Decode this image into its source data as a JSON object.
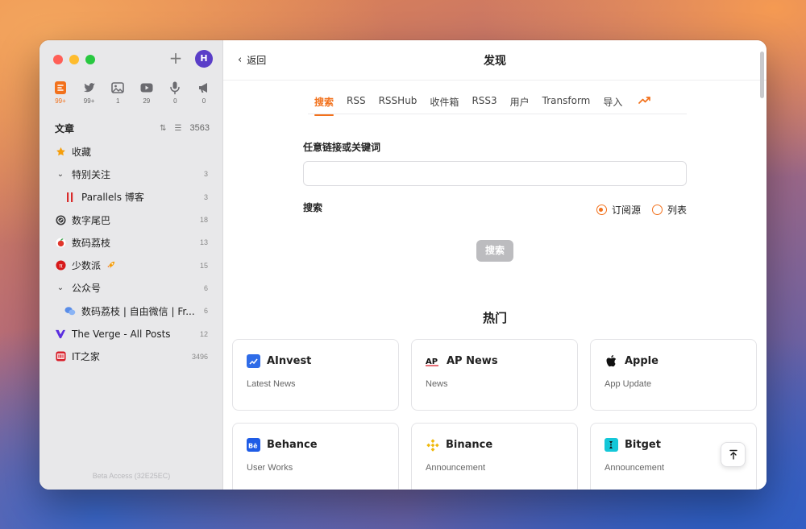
{
  "sidebar": {
    "view_counts": [
      "99+",
      "99+",
      "1",
      "29",
      "0",
      "0"
    ],
    "section_title": "文章",
    "total_count": "3563",
    "feeds": [
      {
        "name": "收藏",
        "count": ""
      },
      {
        "name": "特别关注",
        "count": "3"
      },
      {
        "name": "Parallels 博客",
        "count": "3"
      },
      {
        "name": "数字尾巴",
        "count": "18"
      },
      {
        "name": "数码荔枝",
        "count": "13"
      },
      {
        "name": "少数派",
        "count": "15"
      },
      {
        "name": "公众号",
        "count": "6"
      },
      {
        "name": "数码荔枝 | 自由微信 | Fr...",
        "count": "6"
      },
      {
        "name": "The Verge - All Posts",
        "count": "12"
      },
      {
        "name": "IT之家",
        "count": "3496"
      }
    ],
    "beta_label": "Beta Access (32E25EC)",
    "avatar_letter": "H"
  },
  "header": {
    "back_label": "返回",
    "title": "发现"
  },
  "tabs": [
    "搜索",
    "RSS",
    "RSSHub",
    "收件箱",
    "RSS3",
    "用户",
    "Transform",
    "导入"
  ],
  "form": {
    "input_label": "任意链接或关键词",
    "input_value": "",
    "search_label": "搜索",
    "radio_feed": "订阅源",
    "radio_list": "列表",
    "submit_label": "搜索"
  },
  "hot": {
    "title": "热门",
    "cards": [
      {
        "name": "AInvest",
        "sub": "Latest News"
      },
      {
        "name": "AP News",
        "sub": "News"
      },
      {
        "name": "Apple",
        "sub": "App Update"
      },
      {
        "name": "Behance",
        "sub": "User Works"
      },
      {
        "name": "Binance",
        "sub": "Announcement"
      },
      {
        "name": "Bitget",
        "sub": "Announcement"
      }
    ]
  },
  "colors": {
    "accent": "#f2711c",
    "avatar": "#5a3ec8"
  }
}
